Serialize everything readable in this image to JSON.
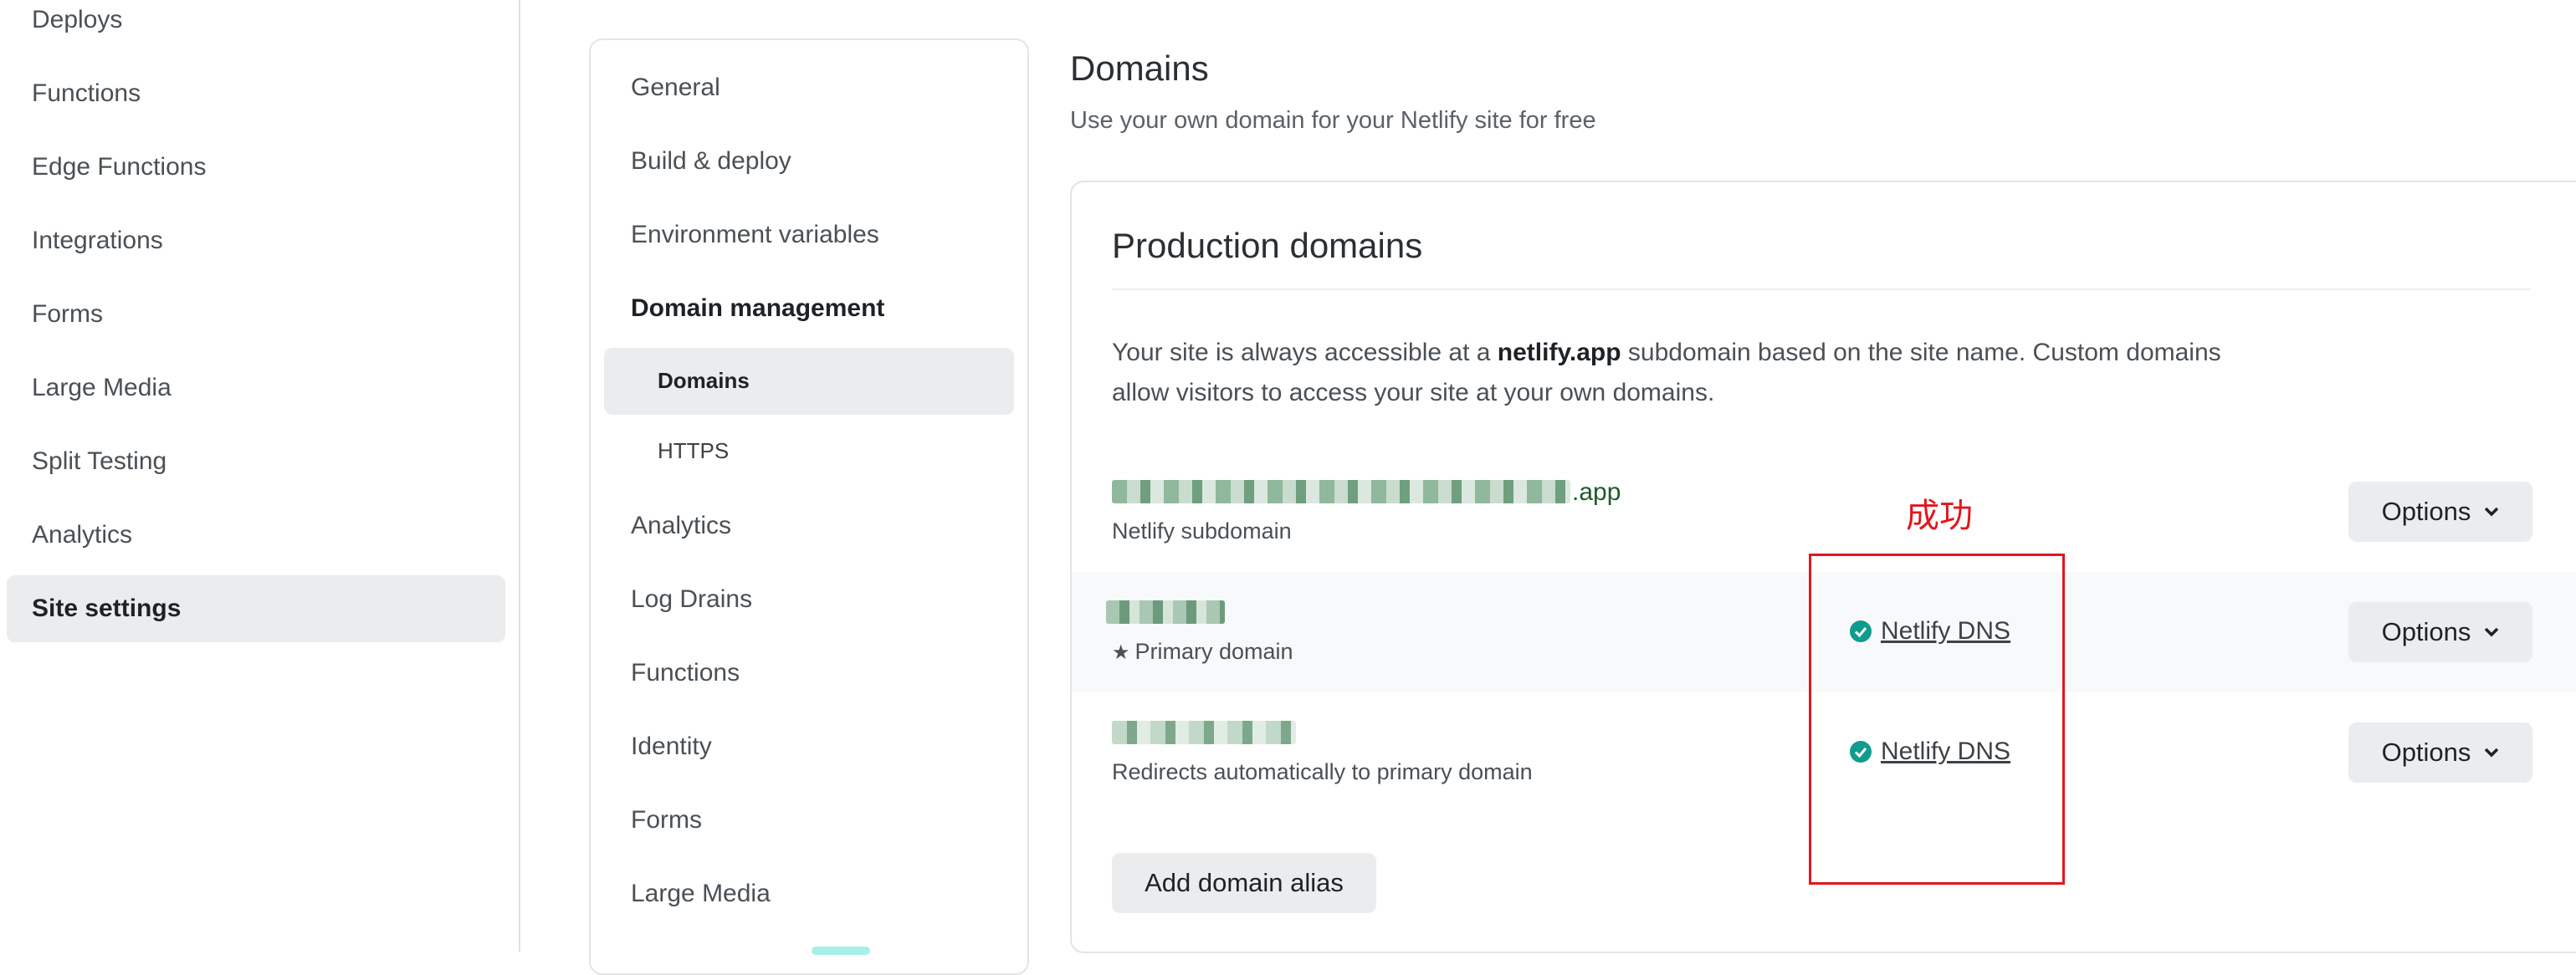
{
  "sidebar": {
    "items": [
      {
        "label": "Deploys"
      },
      {
        "label": "Functions"
      },
      {
        "label": "Edge Functions"
      },
      {
        "label": "Integrations"
      },
      {
        "label": "Forms"
      },
      {
        "label": "Large Media"
      },
      {
        "label": "Split Testing"
      },
      {
        "label": "Analytics"
      },
      {
        "label": "Site settings",
        "active": true
      }
    ]
  },
  "settings_nav": {
    "items": [
      {
        "label": "General"
      },
      {
        "label": "Build & deploy"
      },
      {
        "label": "Environment variables"
      },
      {
        "label": "Domain management",
        "active": true
      },
      {
        "label": "Domains",
        "sub": true,
        "active": true
      },
      {
        "label": "HTTPS",
        "sub": true
      },
      {
        "label": "Analytics"
      },
      {
        "label": "Log Drains"
      },
      {
        "label": "Functions"
      },
      {
        "label": "Identity"
      },
      {
        "label": "Forms"
      },
      {
        "label": "Large Media"
      }
    ]
  },
  "page": {
    "title": "Domains",
    "subtitle": "Use your own domain for your Netlify site for free"
  },
  "production": {
    "title": "Production domains",
    "desc_prefix": "Your site is always accessible at a ",
    "desc_bold": "netlify.app",
    "desc_suffix": " subdomain based on the site name. Custom domains allow visitors to access your site at your own domains.",
    "domains": [
      {
        "name_suffix": ".app",
        "subtitle": "Netlify subdomain",
        "dns": "",
        "options": "Options"
      },
      {
        "subtitle": "Primary domain",
        "dns": "Netlify DNS",
        "options": "Options"
      },
      {
        "subtitle": "Redirects automatically to primary domain",
        "dns": "Netlify DNS",
        "options": "Options"
      }
    ],
    "add_alias_label": "Add domain alias"
  },
  "annotation": {
    "label": "成功",
    "color": "#e0171d"
  },
  "colors": {
    "accent": "#0f9b8e",
    "active_bg": "#ebecee"
  }
}
